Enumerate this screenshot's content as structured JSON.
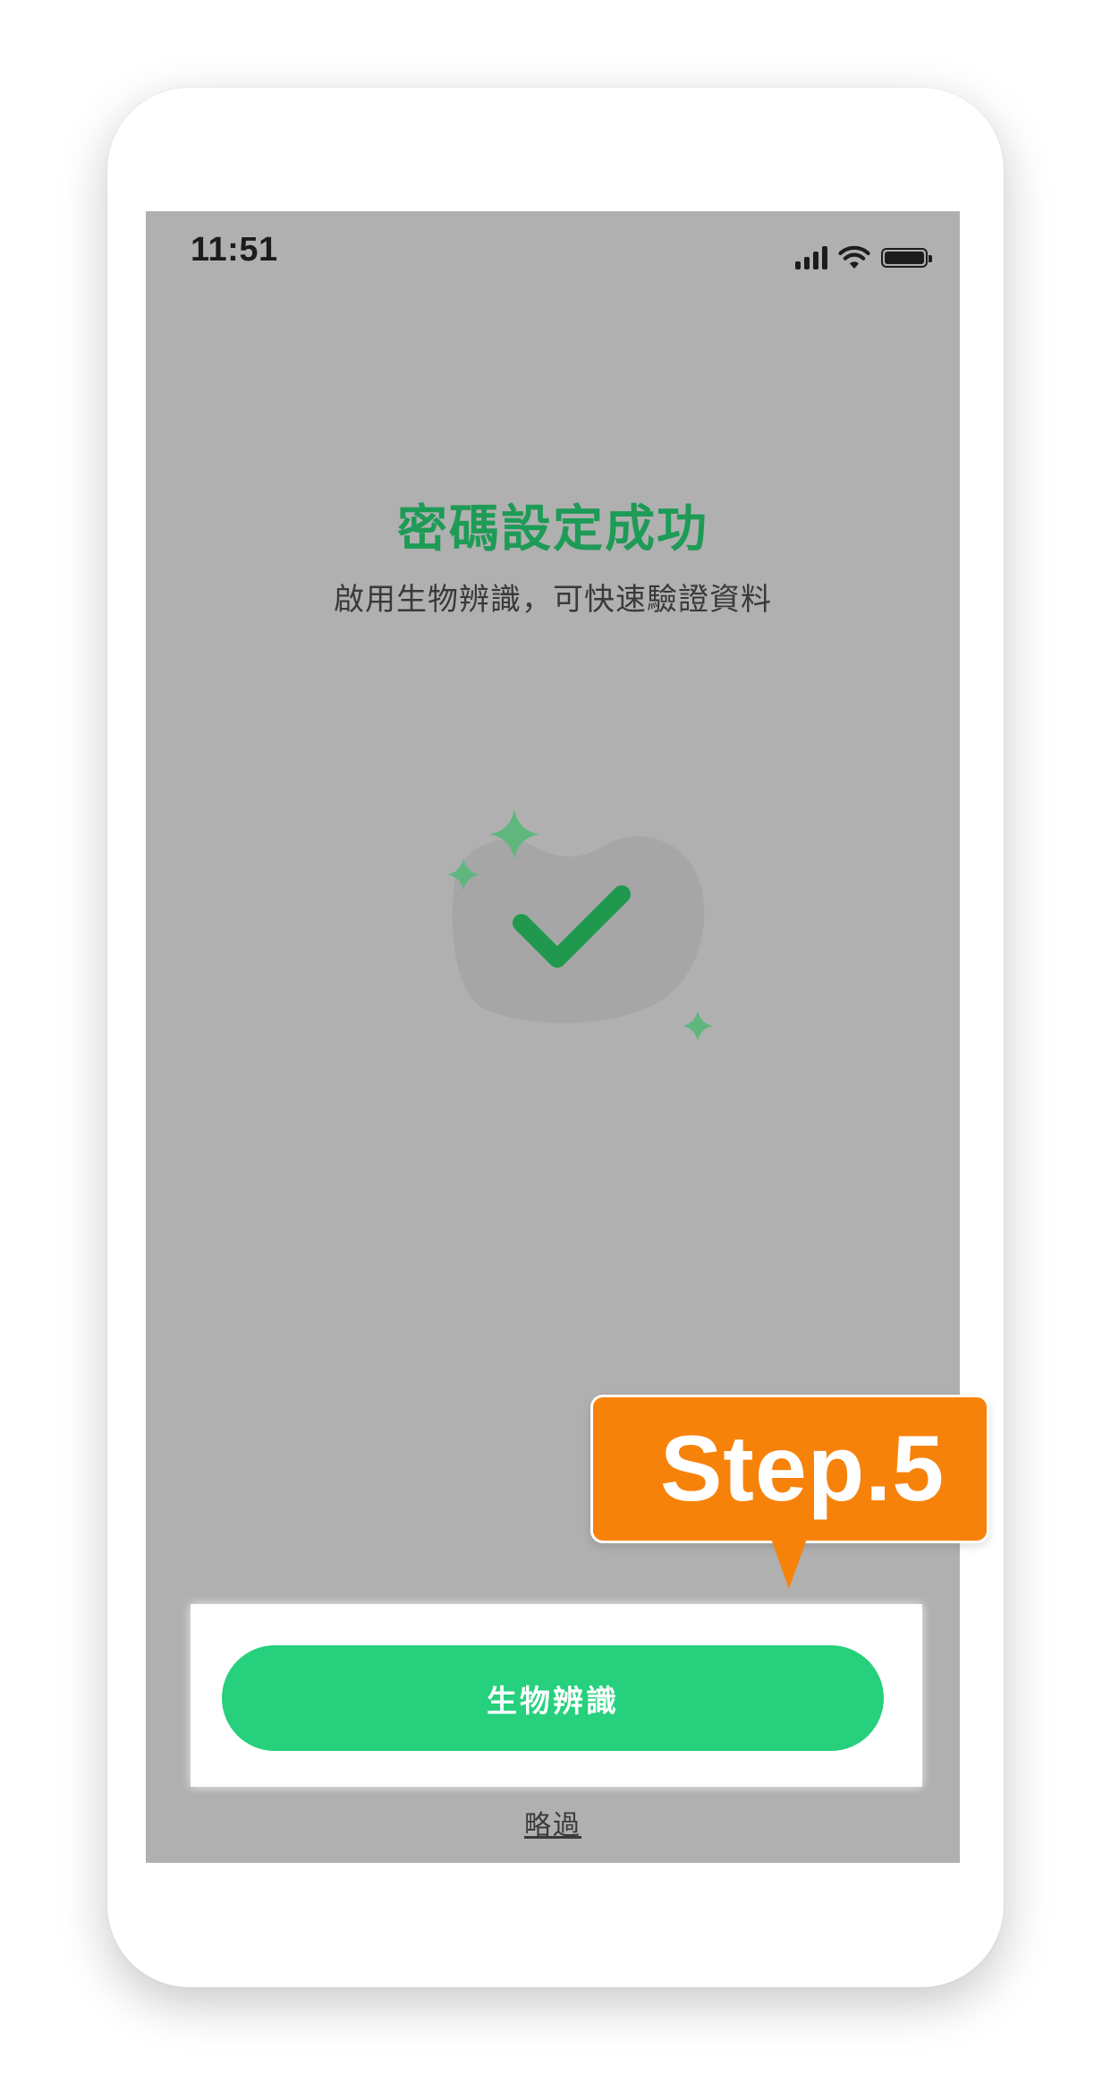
{
  "status_bar": {
    "time": "11:51",
    "icons": [
      "cellular-signal-icon",
      "wifi-icon",
      "battery-icon"
    ]
  },
  "content": {
    "title": "密碼設定成功",
    "subtitle": "啟用生物辨識，可快速驗證資料",
    "illustration_icon": "checkmark-sparkle-icon"
  },
  "actions": {
    "primary_button_label": "生物辨識",
    "skip_link_label": "略過"
  },
  "callout": {
    "label": "Step.5"
  },
  "colors": {
    "accent_green": "#26d07c",
    "title_green": "#1e9b56",
    "callout_orange": "#f7820a",
    "screen_overlay": "#b0b0b0"
  }
}
